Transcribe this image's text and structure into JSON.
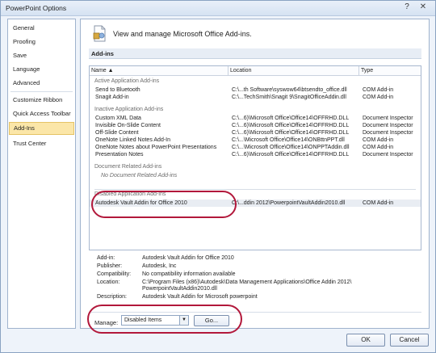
{
  "window": {
    "title": "PowerPoint Options",
    "help_glyph": "?",
    "close_glyph": "✕"
  },
  "nav": {
    "items": [
      {
        "label": "General"
      },
      {
        "label": "Proofing"
      },
      {
        "label": "Save"
      },
      {
        "label": "Language"
      },
      {
        "label": "Advanced"
      },
      {
        "label": "Customize Ribbon"
      },
      {
        "label": "Quick Access Toolbar"
      },
      {
        "label": "Add-Ins",
        "selected": true
      },
      {
        "label": "Trust Center"
      }
    ]
  },
  "header": {
    "text": "View and manage Microsoft Office Add-ins."
  },
  "section": {
    "title": "Add-ins"
  },
  "columns": {
    "name": "Name ▲",
    "location": "Location",
    "type": "Type"
  },
  "groups": [
    {
      "title": "Active Application Add-ins",
      "rows": [
        {
          "name": "Send to Bluetooth",
          "location": "C:\\...th Software\\syswow64\\btsendto_office.dll",
          "type": "COM Add-in"
        },
        {
          "name": "Snagit Add-in",
          "location": "C:\\...TechSmith\\Snagit 9\\SnagitOfficeAddin.dll",
          "type": "COM Add-in"
        }
      ]
    },
    {
      "title": "Inactive Application Add-ins",
      "rows": [
        {
          "name": "Custom XML Data",
          "location": "C:\\...6)\\Microsoft Office\\Office14\\OFFRHD.DLL",
          "type": "Document Inspector"
        },
        {
          "name": "Invisible On-Slide Content",
          "location": "C:\\...6)\\Microsoft Office\\Office14\\OFFRHD.DLL",
          "type": "Document Inspector"
        },
        {
          "name": "Off-Slide Content",
          "location": "C:\\...6)\\Microsoft Office\\Office14\\OFFRHD.DLL",
          "type": "Document Inspector"
        },
        {
          "name": "OneNote Linked Notes Add-In",
          "location": "C:\\...\\Microsoft Office\\Office14\\ONBttnPPT.dll",
          "type": "COM Add-in"
        },
        {
          "name": "OneNote Notes about PowerPoint Presentations",
          "location": "C:\\...\\Microsoft Office\\Office14\\ONPPTAddin.dll",
          "type": "COM Add-in"
        },
        {
          "name": "Presentation Notes",
          "location": "C:\\...6)\\Microsoft Office\\Office14\\OFFRHD.DLL",
          "type": "Document Inspector"
        }
      ]
    },
    {
      "title": "Document Related Add-ins",
      "empty_text": "No Document Related Add-ins",
      "rows": []
    },
    {
      "title": "Disabled Application Add-ins",
      "rows": [
        {
          "name": "Autodesk Vault Addin for Office 2010",
          "location": "C:\\...ddin 2012\\PowerpointVaultAddin2010.dll",
          "type": "COM Add-in",
          "selected": true
        }
      ]
    }
  ],
  "details": {
    "addin_label": "Add-in:",
    "addin_value": "Autodesk Vault Addin for Office 2010",
    "publisher_label": "Publisher:",
    "publisher_value": "Autodesk, Inc",
    "compat_label": "Compatibility:",
    "compat_value": "No compatibility information available",
    "location_label": "Location:",
    "location_value_1": "C:\\Program Files (x86)\\Autodesk\\Data Management Applications\\Office Addin 2012\\",
    "location_value_2": "PowerpointVaultAddin2010.dll",
    "description_label": "Description:",
    "description_value": "Autodesk Vault Addin for Microsoft powerpoint"
  },
  "manage": {
    "label": "Manage:",
    "selected": "Disabled Items",
    "arrow": "▼",
    "go_label": "Go..."
  },
  "footer": {
    "ok_label": "OK",
    "cancel_label": "Cancel"
  },
  "colors": {
    "annotation": "#b2183b",
    "selection": "#fbe6a8"
  }
}
